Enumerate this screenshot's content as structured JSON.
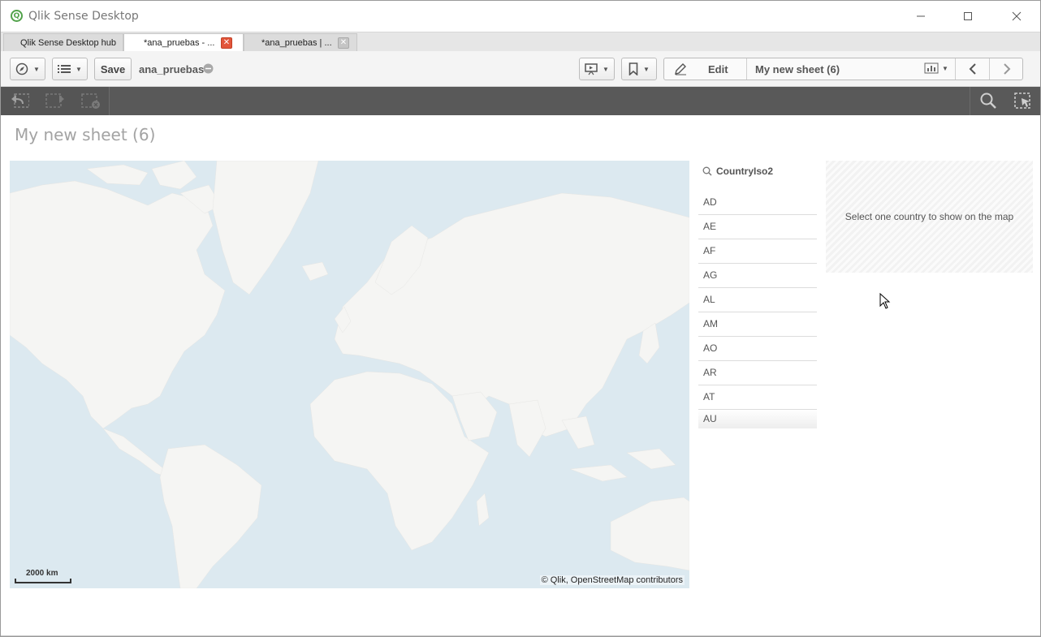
{
  "window": {
    "title": "Qlik Sense Desktop",
    "logo_letter": "Q",
    "controls": [
      "minimize",
      "maximize",
      "close"
    ]
  },
  "tabs": [
    {
      "label": "Qlik Sense Desktop hub",
      "active": false,
      "closable": false
    },
    {
      "label": "*ana_pruebas - ...",
      "active": true,
      "closable": true
    },
    {
      "label": "*ana_pruebas | ...",
      "active": false,
      "closable": true
    }
  ],
  "toolbar": {
    "save_label": "Save",
    "app_name": "ana_pruebas",
    "edit_label": "Edit",
    "sheet_name": "My new sheet (6)"
  },
  "sheet": {
    "title": "My new sheet (6)"
  },
  "map": {
    "scale_label": "2000 km",
    "attribution": "© Qlik, OpenStreetMap contributors",
    "colors": {
      "water": "#dce9f0",
      "land": "#f5f5f3"
    }
  },
  "filter_pane": {
    "title": "CountryIso2",
    "items": [
      "AD",
      "AE",
      "AF",
      "AG",
      "AL",
      "AM",
      "AO",
      "AR",
      "AT",
      "AU"
    ]
  },
  "placeholder": {
    "text": "Select one country to show on the map"
  },
  "icons": [
    "qlik-logo-icon",
    "compass-icon",
    "list-icon",
    "presentation-icon",
    "bookmark-icon",
    "pencil-icon",
    "chart-icon",
    "chevron-left-icon",
    "chevron-right-icon",
    "step-back-icon",
    "step-forward-icon",
    "clear-selections-icon",
    "search-icon",
    "selections-tool-icon"
  ]
}
